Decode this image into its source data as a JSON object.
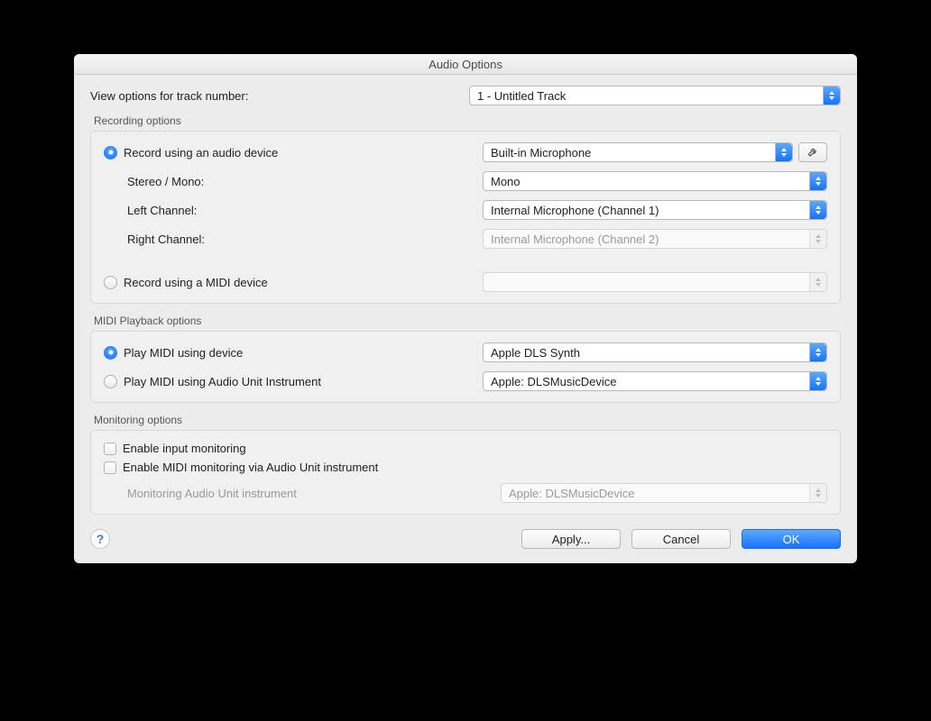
{
  "window": {
    "title": "Audio Options"
  },
  "track_selector": {
    "label": "View options for track number:",
    "value": "1 - Untitled Track"
  },
  "recording": {
    "title": "Recording options",
    "radio_audio": "Record using an audio device",
    "device_value": "Built-in Microphone",
    "stereo_label": "Stereo / Mono:",
    "stereo_value": "Mono",
    "left_label": "Left Channel:",
    "left_value": "Internal Microphone (Channel 1)",
    "right_label": "Right Channel:",
    "right_value": "Internal Microphone (Channel 2)",
    "radio_midi": "Record using a MIDI device",
    "midi_value": ""
  },
  "midi_playback": {
    "title": "MIDI Playback options",
    "radio_device": "Play MIDI using device",
    "device_value": "Apple DLS Synth",
    "radio_au": "Play MIDI using Audio Unit Instrument",
    "au_value": "Apple: DLSMusicDevice"
  },
  "monitoring": {
    "title": "Monitoring options",
    "enable_input": "Enable input monitoring",
    "enable_midi": "Enable MIDI monitoring via Audio Unit instrument",
    "au_label": "Monitoring Audio Unit instrument",
    "au_value": "Apple: DLSMusicDevice"
  },
  "footer": {
    "apply": "Apply...",
    "cancel": "Cancel",
    "ok": "OK"
  }
}
